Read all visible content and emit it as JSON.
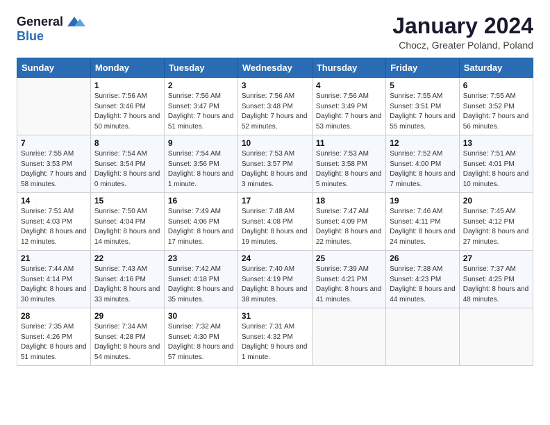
{
  "header": {
    "logo_line1": "General",
    "logo_line2": "Blue",
    "month_year": "January 2024",
    "location": "Chocz, Greater Poland, Poland"
  },
  "days_of_week": [
    "Sunday",
    "Monday",
    "Tuesday",
    "Wednesday",
    "Thursday",
    "Friday",
    "Saturday"
  ],
  "weeks": [
    [
      {
        "day": "",
        "sunrise": "",
        "sunset": "",
        "daylight": ""
      },
      {
        "day": "1",
        "sunrise": "Sunrise: 7:56 AM",
        "sunset": "Sunset: 3:46 PM",
        "daylight": "Daylight: 7 hours and 50 minutes."
      },
      {
        "day": "2",
        "sunrise": "Sunrise: 7:56 AM",
        "sunset": "Sunset: 3:47 PM",
        "daylight": "Daylight: 7 hours and 51 minutes."
      },
      {
        "day": "3",
        "sunrise": "Sunrise: 7:56 AM",
        "sunset": "Sunset: 3:48 PM",
        "daylight": "Daylight: 7 hours and 52 minutes."
      },
      {
        "day": "4",
        "sunrise": "Sunrise: 7:56 AM",
        "sunset": "Sunset: 3:49 PM",
        "daylight": "Daylight: 7 hours and 53 minutes."
      },
      {
        "day": "5",
        "sunrise": "Sunrise: 7:55 AM",
        "sunset": "Sunset: 3:51 PM",
        "daylight": "Daylight: 7 hours and 55 minutes."
      },
      {
        "day": "6",
        "sunrise": "Sunrise: 7:55 AM",
        "sunset": "Sunset: 3:52 PM",
        "daylight": "Daylight: 7 hours and 56 minutes."
      }
    ],
    [
      {
        "day": "7",
        "sunrise": "Sunrise: 7:55 AM",
        "sunset": "Sunset: 3:53 PM",
        "daylight": "Daylight: 7 hours and 58 minutes."
      },
      {
        "day": "8",
        "sunrise": "Sunrise: 7:54 AM",
        "sunset": "Sunset: 3:54 PM",
        "daylight": "Daylight: 8 hours and 0 minutes."
      },
      {
        "day": "9",
        "sunrise": "Sunrise: 7:54 AM",
        "sunset": "Sunset: 3:56 PM",
        "daylight": "Daylight: 8 hours and 1 minute."
      },
      {
        "day": "10",
        "sunrise": "Sunrise: 7:53 AM",
        "sunset": "Sunset: 3:57 PM",
        "daylight": "Daylight: 8 hours and 3 minutes."
      },
      {
        "day": "11",
        "sunrise": "Sunrise: 7:53 AM",
        "sunset": "Sunset: 3:58 PM",
        "daylight": "Daylight: 8 hours and 5 minutes."
      },
      {
        "day": "12",
        "sunrise": "Sunrise: 7:52 AM",
        "sunset": "Sunset: 4:00 PM",
        "daylight": "Daylight: 8 hours and 7 minutes."
      },
      {
        "day": "13",
        "sunrise": "Sunrise: 7:51 AM",
        "sunset": "Sunset: 4:01 PM",
        "daylight": "Daylight: 8 hours and 10 minutes."
      }
    ],
    [
      {
        "day": "14",
        "sunrise": "Sunrise: 7:51 AM",
        "sunset": "Sunset: 4:03 PM",
        "daylight": "Daylight: 8 hours and 12 minutes."
      },
      {
        "day": "15",
        "sunrise": "Sunrise: 7:50 AM",
        "sunset": "Sunset: 4:04 PM",
        "daylight": "Daylight: 8 hours and 14 minutes."
      },
      {
        "day": "16",
        "sunrise": "Sunrise: 7:49 AM",
        "sunset": "Sunset: 4:06 PM",
        "daylight": "Daylight: 8 hours and 17 minutes."
      },
      {
        "day": "17",
        "sunrise": "Sunrise: 7:48 AM",
        "sunset": "Sunset: 4:08 PM",
        "daylight": "Daylight: 8 hours and 19 minutes."
      },
      {
        "day": "18",
        "sunrise": "Sunrise: 7:47 AM",
        "sunset": "Sunset: 4:09 PM",
        "daylight": "Daylight: 8 hours and 22 minutes."
      },
      {
        "day": "19",
        "sunrise": "Sunrise: 7:46 AM",
        "sunset": "Sunset: 4:11 PM",
        "daylight": "Daylight: 8 hours and 24 minutes."
      },
      {
        "day": "20",
        "sunrise": "Sunrise: 7:45 AM",
        "sunset": "Sunset: 4:12 PM",
        "daylight": "Daylight: 8 hours and 27 minutes."
      }
    ],
    [
      {
        "day": "21",
        "sunrise": "Sunrise: 7:44 AM",
        "sunset": "Sunset: 4:14 PM",
        "daylight": "Daylight: 8 hours and 30 minutes."
      },
      {
        "day": "22",
        "sunrise": "Sunrise: 7:43 AM",
        "sunset": "Sunset: 4:16 PM",
        "daylight": "Daylight: 8 hours and 33 minutes."
      },
      {
        "day": "23",
        "sunrise": "Sunrise: 7:42 AM",
        "sunset": "Sunset: 4:18 PM",
        "daylight": "Daylight: 8 hours and 35 minutes."
      },
      {
        "day": "24",
        "sunrise": "Sunrise: 7:40 AM",
        "sunset": "Sunset: 4:19 PM",
        "daylight": "Daylight: 8 hours and 38 minutes."
      },
      {
        "day": "25",
        "sunrise": "Sunrise: 7:39 AM",
        "sunset": "Sunset: 4:21 PM",
        "daylight": "Daylight: 8 hours and 41 minutes."
      },
      {
        "day": "26",
        "sunrise": "Sunrise: 7:38 AM",
        "sunset": "Sunset: 4:23 PM",
        "daylight": "Daylight: 8 hours and 44 minutes."
      },
      {
        "day": "27",
        "sunrise": "Sunrise: 7:37 AM",
        "sunset": "Sunset: 4:25 PM",
        "daylight": "Daylight: 8 hours and 48 minutes."
      }
    ],
    [
      {
        "day": "28",
        "sunrise": "Sunrise: 7:35 AM",
        "sunset": "Sunset: 4:26 PM",
        "daylight": "Daylight: 8 hours and 51 minutes."
      },
      {
        "day": "29",
        "sunrise": "Sunrise: 7:34 AM",
        "sunset": "Sunset: 4:28 PM",
        "daylight": "Daylight: 8 hours and 54 minutes."
      },
      {
        "day": "30",
        "sunrise": "Sunrise: 7:32 AM",
        "sunset": "Sunset: 4:30 PM",
        "daylight": "Daylight: 8 hours and 57 minutes."
      },
      {
        "day": "31",
        "sunrise": "Sunrise: 7:31 AM",
        "sunset": "Sunset: 4:32 PM",
        "daylight": "Daylight: 9 hours and 1 minute."
      },
      {
        "day": "",
        "sunrise": "",
        "sunset": "",
        "daylight": ""
      },
      {
        "day": "",
        "sunrise": "",
        "sunset": "",
        "daylight": ""
      },
      {
        "day": "",
        "sunrise": "",
        "sunset": "",
        "daylight": ""
      }
    ]
  ]
}
